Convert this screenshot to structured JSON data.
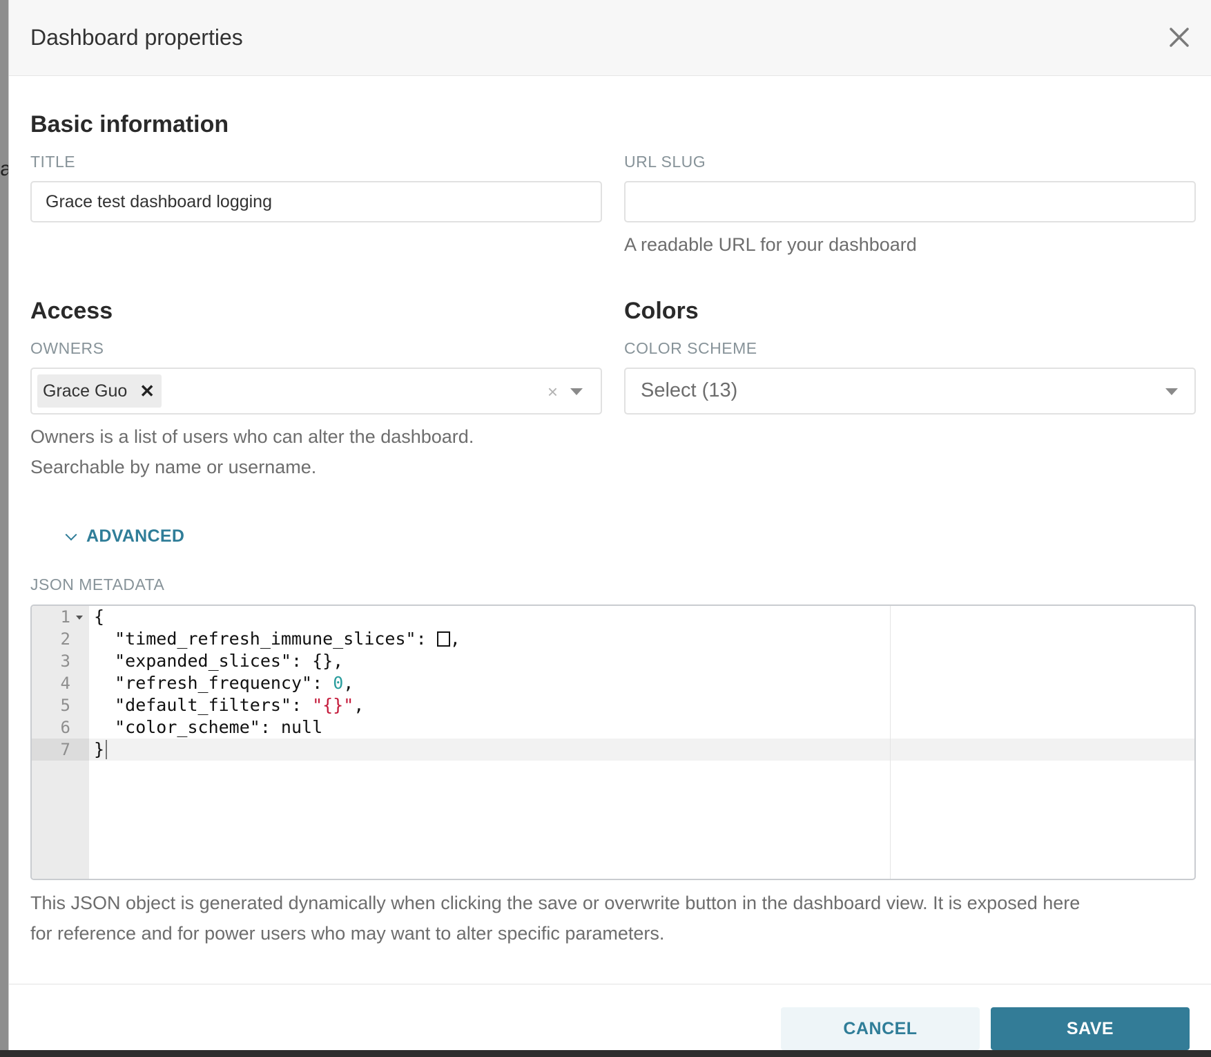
{
  "modal": {
    "title": "Dashboard properties"
  },
  "basic_info": {
    "heading": "Basic information",
    "title_label": "TITLE",
    "title_value": "Grace test dashboard logging",
    "slug_label": "URL SLUG",
    "slug_value": "",
    "slug_help": "A readable URL for your dashboard"
  },
  "access": {
    "heading": "Access",
    "owners_label": "OWNERS",
    "owners": [
      "Grace Guo"
    ],
    "owners_help_line1": "Owners is a list of users who can alter the dashboard.",
    "owners_help_line2": "Searchable by name or username."
  },
  "colors": {
    "heading": "Colors",
    "scheme_label": "COLOR SCHEME",
    "scheme_value": "Select (13)"
  },
  "advanced": {
    "toggle_label": "ADVANCED",
    "json_label": "JSON METADATA",
    "line_numbers": [
      "1",
      "2",
      "3",
      "4",
      "5",
      "6",
      "7"
    ],
    "code_lines": {
      "l1": "{",
      "l2_key": "  \"timed_refresh_immune_slices\": ",
      "l2_tail": ",",
      "l3": "  \"expanded_slices\": {},",
      "l4_key": "  \"refresh_frequency\": ",
      "l4_num": "0",
      "l4_tail": ",",
      "l5_key": "  \"default_filters\": ",
      "l5_str": "\"{}\"",
      "l5_tail": ",",
      "l6": "  \"color_scheme\": null",
      "l7": "}"
    },
    "json_help_line1": "This JSON object is generated dynamically when clicking the save or overwrite button in the dashboard view. It is exposed here",
    "json_help_line2": "for reference and for power users who may want to alter specific parameters."
  },
  "footer": {
    "cancel_label": "CANCEL",
    "save_label": "SAVE"
  },
  "colors_ui": {
    "accent": "#337c97",
    "label_gray": "#879399",
    "number_token": "#2a9d9d",
    "string_token": "#c41a3a"
  },
  "icons": [
    "close-icon",
    "tag-remove-icon",
    "clear-icon",
    "chevron-down-icon",
    "fold-arrow-icon"
  ]
}
